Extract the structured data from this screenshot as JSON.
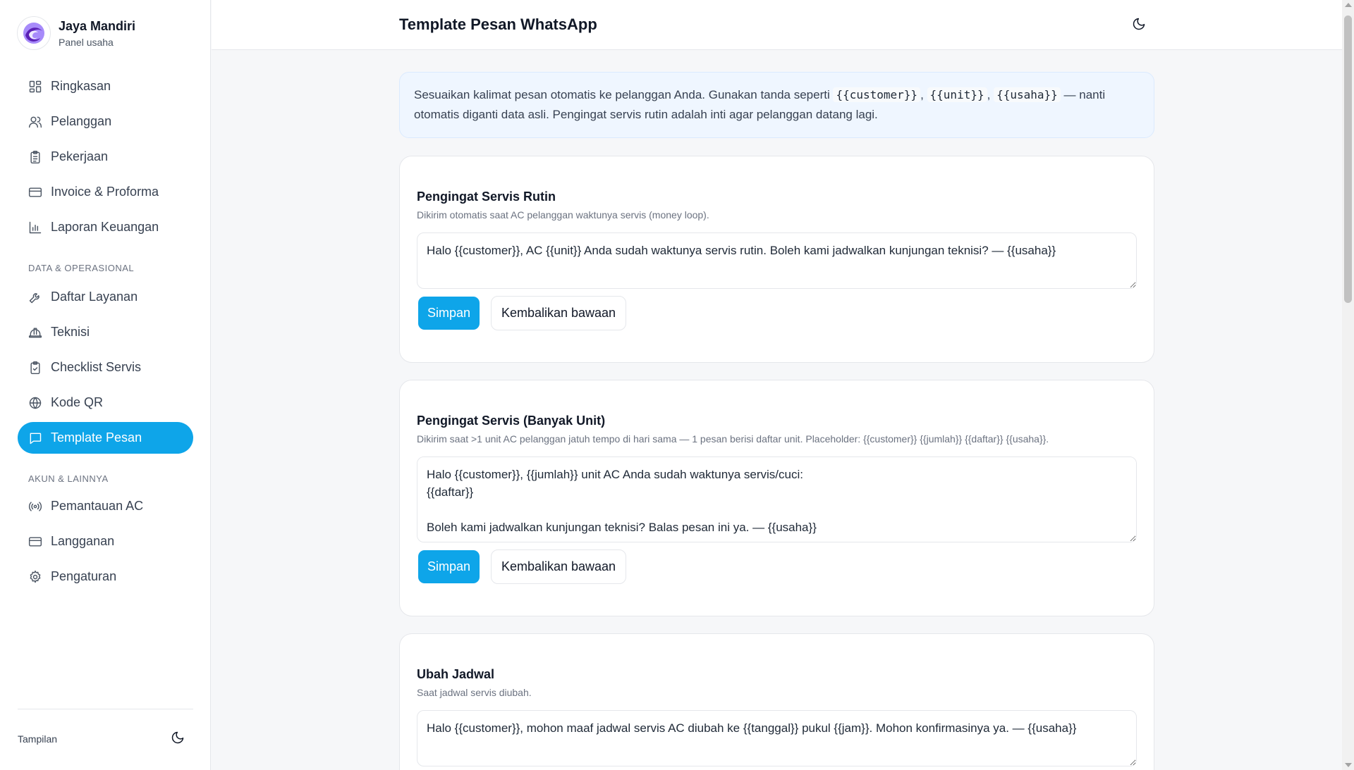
{
  "brand": {
    "name": "Jaya Mandiri",
    "subtitle": "Panel usaha"
  },
  "header": {
    "title": "Template Pesan WhatsApp",
    "theme_icon": "moon-icon"
  },
  "nav": {
    "main": [
      {
        "label": "Ringkasan",
        "icon": "dashboard-icon"
      },
      {
        "label": "Pelanggan",
        "icon": "users-icon"
      },
      {
        "label": "Pekerjaan",
        "icon": "clipboard-icon"
      },
      {
        "label": "Invoice & Proforma",
        "icon": "credit-card-icon"
      },
      {
        "label": "Laporan Keuangan",
        "icon": "bar-chart-icon"
      }
    ],
    "section_data": "DATA & OPERASIONAL",
    "data": [
      {
        "label": "Daftar Layanan",
        "icon": "wrench-icon"
      },
      {
        "label": "Teknisi",
        "icon": "hard-hat-icon"
      },
      {
        "label": "Checklist Servis",
        "icon": "clipboard-check-icon"
      },
      {
        "label": "Kode QR",
        "icon": "globe-icon"
      },
      {
        "label": "Template Pesan",
        "icon": "message-icon",
        "active": true
      }
    ],
    "section_account": "AKUN & LAINNYA",
    "account": [
      {
        "label": "Pemantauan AC",
        "icon": "radio-icon"
      },
      {
        "label": "Langganan",
        "icon": "credit-card-icon"
      },
      {
        "label": "Pengaturan",
        "icon": "gear-icon"
      }
    ]
  },
  "footer": {
    "label": "Tampilan",
    "icon": "moon-icon"
  },
  "info": {
    "text_1": "Sesuaikan kalimat pesan otomatis ke pelanggan Anda. Gunakan tanda seperti",
    "code_1": "{{customer}}",
    "code_2": "{{unit}}",
    "code_3": "{{usaha}}",
    "sep": ",",
    "text_2": "—",
    "text_3": "nanti otomatis diganti data asli. Pengingat servis rutin adalah inti agar pelanggan datang lagi."
  },
  "templates": [
    {
      "title": "Pengingat Servis Rutin",
      "description": "Dikirim otomatis saat AC pelanggan waktunya servis (money loop).",
      "message": "Halo {{customer}}, AC {{unit}} Anda sudah waktunya servis rutin. Boleh kami jadwalkan kunjungan teknisi? — {{usaha}}",
      "save_label": "Simpan",
      "reset_label": "Kembalikan bawaan"
    },
    {
      "title": "Pengingat Servis (Banyak Unit)",
      "description": "Dikirim saat >1 unit AC pelanggan jatuh tempo di hari sama — 1 pesan berisi daftar unit. Placeholder: {{customer}} {{jumlah}} {{daftar}} {{usaha}}.",
      "message": "Halo {{customer}}, {{jumlah}} unit AC Anda sudah waktunya servis/cuci:\n{{daftar}}\n\nBoleh kami jadwalkan kunjungan teknisi? Balas pesan ini ya. — {{usaha}}",
      "save_label": "Simpan",
      "reset_label": "Kembalikan bawaan"
    },
    {
      "title": "Ubah Jadwal",
      "description": "Saat jadwal servis diubah.",
      "message": "Halo {{customer}}, mohon maaf jadwal servis AC diubah ke {{tanggal}} pukul {{jam}}. Mohon konfirmasinya ya. — {{usaha}}"
    }
  ],
  "colors": {
    "accent": "#0ea5e9",
    "info_bg": "#eff6ff"
  }
}
